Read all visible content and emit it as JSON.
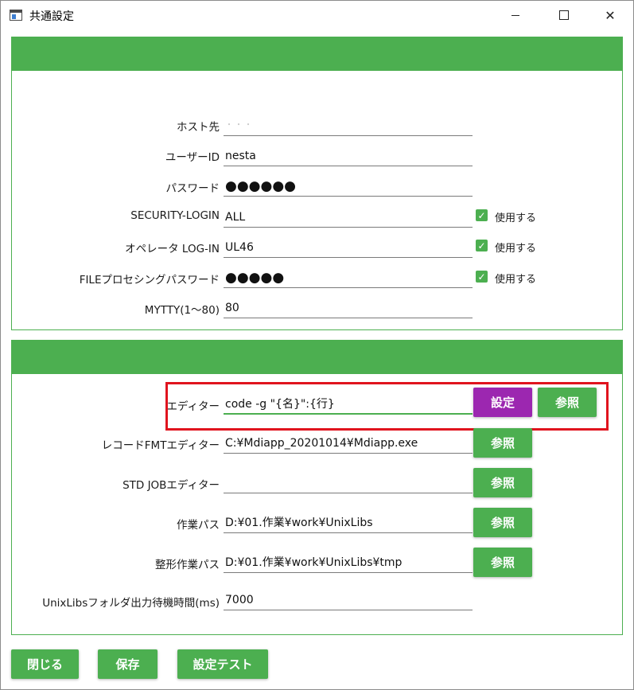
{
  "window": {
    "title": "共通設定"
  },
  "connection": {
    "host_label": "ホスト先",
    "host_value": "・・・",
    "user_label": "ユーザーID",
    "user_value": "nesta",
    "password_label": "パスワード",
    "password_value": "●●●●●●",
    "security_label": "SECURITY-LOGIN",
    "security_value": "ALL",
    "security_check_label": "使用する",
    "operator_label": "オペレータ LOG-IN",
    "operator_value": "UL46",
    "operator_check_label": "使用する",
    "file_pw_label": "FILEプロセシングパスワード",
    "file_pw_value": "●●●●●",
    "file_pw_check_label": "使用する",
    "mytty_label": "MYTTY(1～80)",
    "mytty_value": "80"
  },
  "editors": {
    "editor_label": "エディター",
    "editor_value": "code -g \"{名}\":{行}",
    "set_button": "設定",
    "ref_button": "参照",
    "record_fmt_label": "レコードFMTエディター",
    "record_fmt_value": "C:¥Mdiapp_20201014¥Mdiapp.exe",
    "std_job_label": "STD JOBエディター",
    "std_job_value": "",
    "work_path_label": "作業パス",
    "work_path_value": "D:¥01.作業¥work¥UnixLibs",
    "format_path_label": "整形作業パス",
    "format_path_value": "D:¥01.作業¥work¥UnixLibs¥tmp",
    "wait_label": "UnixLibsフォルダ出力待機時間(ms)",
    "wait_value": "7000"
  },
  "footer": {
    "close_button": "閉じる",
    "save_button": "保存",
    "test_button": "設定テスト"
  },
  "colors": {
    "accent": "#4caf50",
    "purple": "#9c27b0",
    "highlight": "#e0141e"
  }
}
